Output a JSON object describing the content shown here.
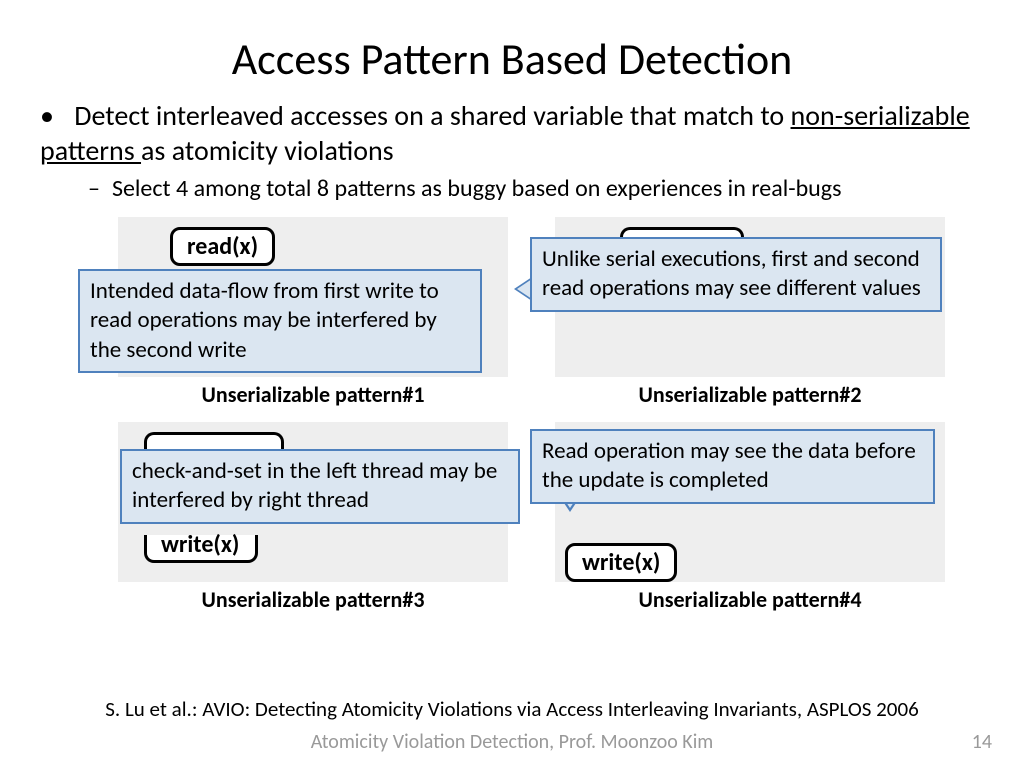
{
  "title": "Access Pattern Based Detection",
  "bullet_main_prefix": "Detect interleaved accesses on a shared variable that match to ",
  "bullet_main_underline": "non-serializable patterns ",
  "bullet_main_suffix": "as atomicity violations",
  "bullet_sub": "Select 4 among total 8 patterns as buggy based on experiences in real-bugs",
  "ops": {
    "read1": "read(x)",
    "write4": "write(x)",
    "write3_bot": "write(x)"
  },
  "captions": {
    "p1": "Unserializable pattern#1",
    "p2": "Unserializable pattern#2",
    "p3": "Unserializable pattern#3",
    "p4": "Unserializable pattern#4"
  },
  "callouts": {
    "c1": "Intended data-flow from first write to read operations may be interfered by the second write",
    "c2": "Unlike serial executions, first and second read operations may see different values",
    "c3": "check-and-set in the left thread may be interfered by right thread",
    "c4": "Read operation may see the data before the update is completed"
  },
  "citation": "S. Lu et al.: AVIO: Detecting Atomicity Violations via Access Interleaving Invariants, ASPLOS 2006",
  "footer": "Atomicity Violation Detection, Prof. Moonzoo Kim",
  "page": "14"
}
